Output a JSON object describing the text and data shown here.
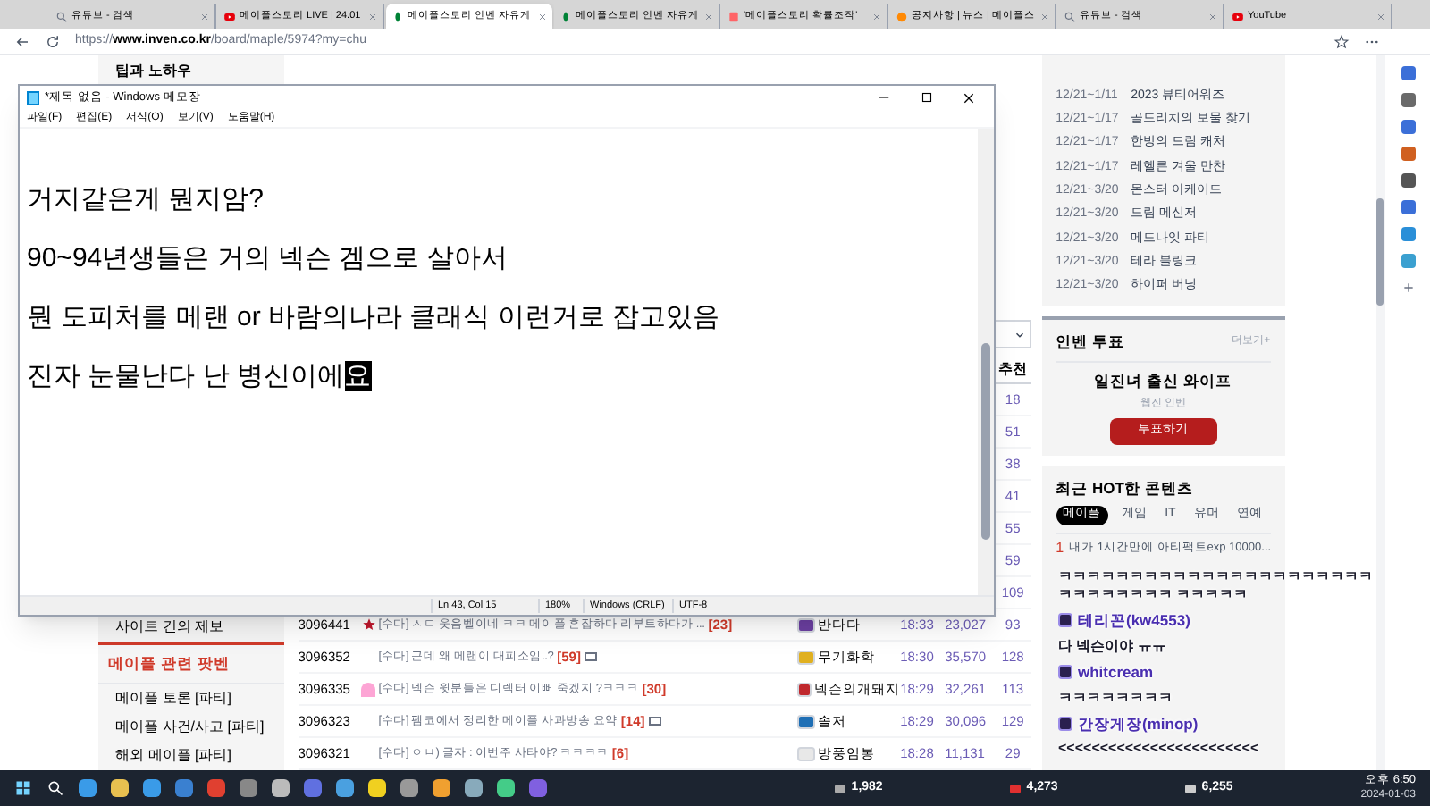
{
  "browser": {
    "tabs": [
      {
        "title": "유튜브 - 검색",
        "kind": "search",
        "selected": false
      },
      {
        "title": "메이플스토리 LIVE | 24.01",
        "kind": "video",
        "selected": false
      },
      {
        "title": "메이플스토리 인벤 자유게",
        "kind": "leaf",
        "selected": true
      },
      {
        "title": "메이플스토리 인벤 자유게",
        "kind": "leaf",
        "selected": false
      },
      {
        "title": "'메이플스토리 확률조작'",
        "kind": "doc",
        "selected": false
      },
      {
        "title": "공지사항 | 뉴스 | 메이플스",
        "kind": "face",
        "selected": false
      },
      {
        "title": "유튜브 - 검색",
        "kind": "search",
        "selected": false
      },
      {
        "title": "YouTube",
        "kind": "video",
        "selected": false
      }
    ],
    "url_prefix": "https://",
    "url_host": "www.inven.co.kr",
    "url_path": "/board/maple/5974?my=chu"
  },
  "sidebar": {
    "top_items": [
      "팁과 노하우"
    ],
    "bottom_items": [
      "사이트 건의 제보"
    ],
    "section_title": "메이플 관련 팟벤",
    "section_items": [
      "메이플 토론 [파티]",
      "메이플 사건/사고 [파티]",
      "해외 메이플 [파티]"
    ]
  },
  "table": {
    "recommend_header": "추천",
    "rows": [
      {
        "recommend": "18"
      },
      {
        "recommend": "51"
      },
      {
        "recommend": "38"
      },
      {
        "recommend": "41"
      },
      {
        "recommend": "55"
      },
      {
        "recommend": "59"
      },
      {
        "recommend": "109"
      },
      {
        "id": "3096441",
        "kind": "star",
        "title": "[수다] ㅅㄷ 웃음벨이네 ㅋㅋ 메이플 흔잡하다 리부트하다가 ...",
        "comments": "[23]",
        "image": false,
        "author": "반다다",
        "color": "#6b3fa0",
        "time": "18:33",
        "views": "23,027",
        "recommend": "93"
      },
      {
        "id": "3096352",
        "kind": "plain",
        "title": "[수다] 근데 왜 메랜이 대피소임..?",
        "comments": "[59]",
        "image": true,
        "author": "무기화학",
        "color": "#e0b020",
        "time": "18:30",
        "views": "35,570",
        "recommend": "128"
      },
      {
        "id": "3096335",
        "kind": "ghost",
        "title": "[수다] 넥슨 윗분들은 디렉터 이뻐 죽겠지 ?ㅋㅋㅋ",
        "comments": "[30]",
        "image": false,
        "author": "넥슨의개돼지",
        "color": "#c0282d",
        "time": "18:29",
        "views": "32,261",
        "recommend": "113"
      },
      {
        "id": "3096323",
        "kind": "plain",
        "title": "[수다] 펨코에서 정리한 메이플 사과방송 요약",
        "comments": "[14]",
        "image": true,
        "author": "솔저",
        "color": "#1f6fb5",
        "time": "18:29",
        "views": "30,096",
        "recommend": "129"
      },
      {
        "id": "3096321",
        "kind": "plain",
        "title": "[수다] ㅇㅂ) 글자 : 이번주 사타야? ㅋㅋㅋㅋ",
        "comments": "[6]",
        "image": false,
        "author": "방풍임봉",
        "color": "#e8e8e8",
        "time": "18:28",
        "views": "11,131",
        "recommend": "29"
      }
    ]
  },
  "events": [
    {
      "date": "12/21~1/11",
      "name": "2023 뷰티어워즈"
    },
    {
      "date": "12/21~1/17",
      "name": "골드리치의 보물 찾기"
    },
    {
      "date": "12/21~1/17",
      "name": "한방의 드림 캐처"
    },
    {
      "date": "12/21~1/17",
      "name": "레헬른 겨울 만찬"
    },
    {
      "date": "12/21~3/20",
      "name": "몬스터 아케이드"
    },
    {
      "date": "12/21~3/20",
      "name": "드림 메신저"
    },
    {
      "date": "12/21~3/20",
      "name": "메드나잇 파티"
    },
    {
      "date": "12/21~3/20",
      "name": "테라 블링크"
    },
    {
      "date": "12/21~3/20",
      "name": "하이퍼 버닝"
    }
  ],
  "vote": {
    "title": "인벤 투표",
    "more": "더보기+",
    "question": "일진녀 출신 와이프",
    "source": "웹진 인벤",
    "button": "투표하기"
  },
  "hot": {
    "title": "최근 HOT한 콘텐츠",
    "tabs": [
      {
        "label": "메이플",
        "selected": true
      },
      {
        "label": "게임",
        "selected": false
      },
      {
        "label": "IT",
        "selected": false
      },
      {
        "label": "유머",
        "selected": false
      },
      {
        "label": "연예",
        "selected": false
      }
    ],
    "items": [
      {
        "rank": "1",
        "title": "내가 1시간만에 아티팩트exp 10000..."
      }
    ]
  },
  "notepad": {
    "title": "*제목 없음 - Windows 메모장",
    "menu": [
      "파일(F)",
      "편집(E)",
      "서식(O)",
      "보기(V)",
      "도움말(H)"
    ],
    "lines": [
      "거지같은게 뭔지암?",
      "90~94년생들은 거의 넥슨 겜으로 살아서",
      "뭔 도피처를 메랜 or 바람의나라 클래식 이런거로 잡고있음",
      "진자 눈물난다 난 병신이에"
    ],
    "selected_text": "요",
    "status": [
      "Ln 43, Col 15",
      "180%",
      "Windows (CRLF)",
      "UTF-8"
    ]
  },
  "chat": [
    {
      "text": "ㅋㅋㅋㅋㅋㅋㅋㅋㅋㅋㅋㅋㅋㅋㅋㅋㅋㅋㅋㅋㅋㅋㅋㅋㅋㅋㅋㅋㅋㅋ ㅋㅋㅋㅋㅋ"
    },
    {
      "user": "테리꼰(kw4553)",
      "text": "다 넥슨이야 ㅠㅠ"
    },
    {
      "user": "whitcream",
      "text": "ㅋㅋㅋㅋㅋㅋㅋㅋ"
    },
    {
      "user": "간장게장(minop)",
      "text": "<<<<<<<<<<<<<<<<<<<<<<<<"
    }
  ],
  "taskbar": {
    "stats": [
      "1,982",
      "4,273",
      "6,255"
    ],
    "time": "오후 6:50",
    "date": "2024-01-03"
  }
}
